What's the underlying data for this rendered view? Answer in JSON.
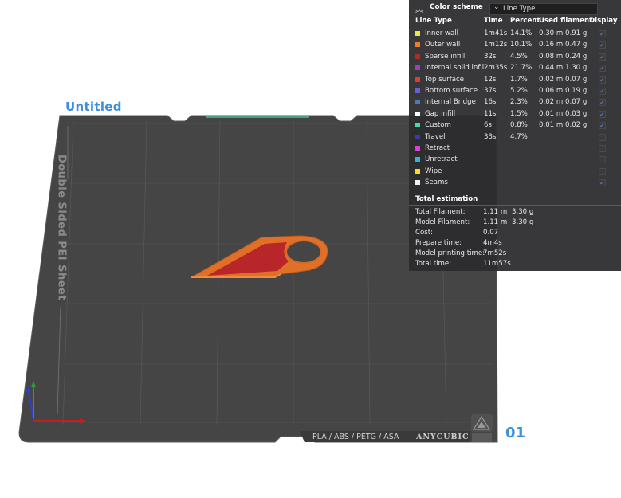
{
  "plate": {
    "title": "Untitled",
    "number": "01",
    "sheet_label": "Double Sided PEI Sheet",
    "materials": "PLA / ABS / PETG / ASA",
    "brand": "ANYCUBIC"
  },
  "legend": {
    "title": "Color scheme",
    "scheme_value": "Line Type",
    "headers": {
      "line_type": "Line Type",
      "time": "Time",
      "percent": "Percent",
      "used_filament": "Used filament",
      "display": "Display"
    },
    "rows": [
      {
        "name": "Inner wall",
        "color": "#f0e64a",
        "time": "1m41s",
        "percent": "14.1%",
        "length": "0.30 m",
        "weight": "0.91 g",
        "display": true
      },
      {
        "name": "Outer wall",
        "color": "#f07c2c",
        "time": "1m12s",
        "percent": "10.1%",
        "length": "0.16 m",
        "weight": "0.47 g",
        "display": true
      },
      {
        "name": "Sparse infill",
        "color": "#b02a2a",
        "time": "32s",
        "percent": "4.5%",
        "length": "0.08 m",
        "weight": "0.24 g",
        "display": true
      },
      {
        "name": "Internal solid infill",
        "color": "#9a3fc0",
        "time": "2m35s",
        "percent": "21.7%",
        "length": "0.44 m",
        "weight": "1.30 g",
        "display": true
      },
      {
        "name": "Top surface",
        "color": "#e03a3a",
        "time": "12s",
        "percent": "1.7%",
        "length": "0.02 m",
        "weight": "0.07 g",
        "display": true
      },
      {
        "name": "Bottom surface",
        "color": "#6a5ed8",
        "time": "37s",
        "percent": "5.2%",
        "length": "0.06 m",
        "weight": "0.19 g",
        "display": true
      },
      {
        "name": "Internal Bridge",
        "color": "#4a7ab8",
        "time": "16s",
        "percent": "2.3%",
        "length": "0.02 m",
        "weight": "0.07 g",
        "display": true
      },
      {
        "name": "Gap infill",
        "color": "#ffffff",
        "time": "11s",
        "percent": "1.5%",
        "length": "0.01 m",
        "weight": "0.03 g",
        "display": true
      },
      {
        "name": "Custom",
        "color": "#4ad8a8",
        "time": "6s",
        "percent": "0.8%",
        "length": "0.01 m",
        "weight": "0.02 g",
        "display": true
      },
      {
        "name": "Travel",
        "color": "#3a3ab0",
        "time": "33s",
        "percent": "4.7%",
        "length": "",
        "weight": "",
        "display": false
      },
      {
        "name": "Retract",
        "color": "#e03ae0",
        "time": "",
        "percent": "",
        "length": "",
        "weight": "",
        "display": false
      },
      {
        "name": "Unretract",
        "color": "#3ab0d8",
        "time": "",
        "percent": "",
        "length": "",
        "weight": "",
        "display": false
      },
      {
        "name": "Wipe",
        "color": "#f0e020",
        "time": "",
        "percent": "",
        "length": "",
        "weight": "",
        "display": false
      },
      {
        "name": "Seams",
        "color": "#f0f0f0",
        "time": "",
        "percent": "",
        "length": "",
        "weight": "",
        "display": true
      }
    ],
    "total_title": "Total estimation",
    "totals": [
      {
        "key": "Total Filament:",
        "v1": "1.11 m",
        "v2": "3.30 g"
      },
      {
        "key": "Model Filament:",
        "v1": "1.11 m",
        "v2": "3.30 g"
      },
      {
        "key": "Cost:",
        "v1": "0.07",
        "v2": ""
      },
      {
        "key": "Prepare time:",
        "v1": "4m4s",
        "v2": ""
      },
      {
        "key": "Model printing time:",
        "v1": "7m52s",
        "v2": ""
      },
      {
        "key": "Total time:",
        "v1": "11m57s",
        "v2": ""
      }
    ]
  },
  "icons": {
    "collapse": "chevron-up-double-icon",
    "dropdown": "chevron-down-icon",
    "check": "check-icon",
    "axes": "axes-gizmo-icon",
    "plate_logo": "anycubic-logo-icon"
  }
}
